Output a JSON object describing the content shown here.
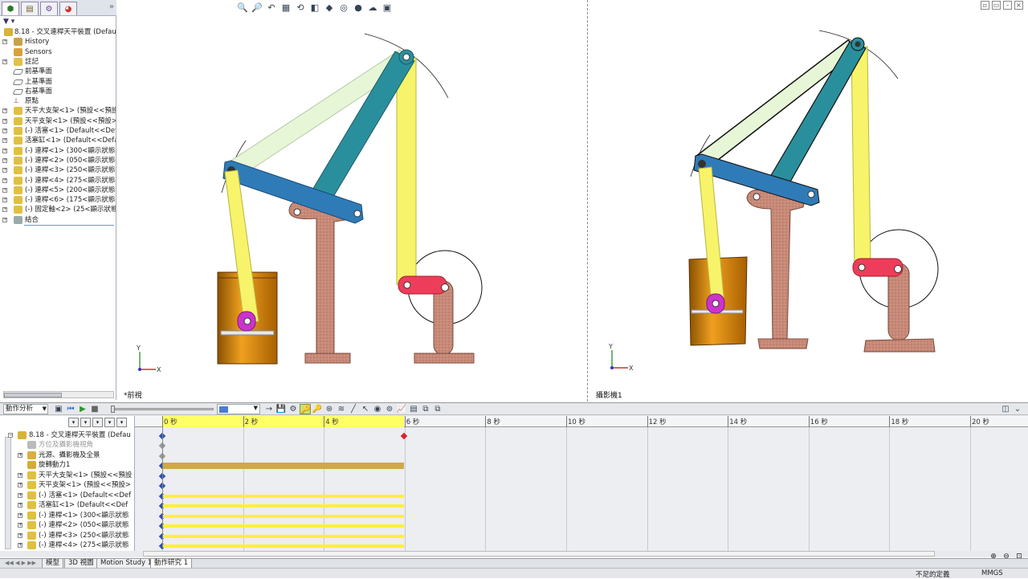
{
  "feature_manager": {
    "tabs": [
      "feature-tree",
      "property-manager",
      "configuration-manager",
      "display-manager"
    ],
    "filter_icon": "filter-icon",
    "items": [
      {
        "label": "8.18 - 交叉連桿天平裝置  (Default",
        "icon": "assembly-icon",
        "expand": ""
      },
      {
        "label": "History",
        "icon": "history-icon",
        "expand": "+"
      },
      {
        "label": "Sensors",
        "icon": "sensors-icon",
        "expand": ""
      },
      {
        "label": "註記",
        "icon": "annotations-icon",
        "expand": "+"
      },
      {
        "label": "前基準面",
        "icon": "plane-icon",
        "expand": ""
      },
      {
        "label": "上基準面",
        "icon": "plane-icon",
        "expand": ""
      },
      {
        "label": "右基準面",
        "icon": "plane-icon",
        "expand": ""
      },
      {
        "label": "原點",
        "icon": "origin-icon",
        "expand": ""
      },
      {
        "label": "天平大支架<1> (預設<<預設",
        "icon": "part-icon",
        "expand": "+"
      },
      {
        "label": "天平支架<1> (預設<<預設>_",
        "icon": "part-icon",
        "expand": "+"
      },
      {
        "label": "(-) 活塞<1> (Default<<Defau",
        "icon": "part-icon",
        "expand": "+"
      },
      {
        "label": "活塞缸<1> (Default<<Defau",
        "icon": "part-icon",
        "expand": "+"
      },
      {
        "label": "(-) 連桿<1> (300<顯示狀態-1",
        "icon": "part-icon",
        "expand": "+"
      },
      {
        "label": "(-) 連桿<2> (050<顯示狀態-3",
        "icon": "part-icon",
        "expand": "+"
      },
      {
        "label": "(-) 連桿<3> (250<顯示狀態-1",
        "icon": "part-icon",
        "expand": "+"
      },
      {
        "label": "(-) 連桿<4> (275<顯示狀態-1",
        "icon": "part-icon",
        "expand": "+"
      },
      {
        "label": "(-) 連桿<5> (200<顯示狀態-9",
        "icon": "part-icon",
        "expand": "+"
      },
      {
        "label": "(-) 連桿<6> (175<顯示狀態-8",
        "icon": "part-icon",
        "expand": "+"
      },
      {
        "label": "(-) 固定軸<2> (25<顯示狀態-",
        "icon": "part-icon",
        "expand": "+"
      },
      {
        "label": "結合",
        "icon": "mates-icon",
        "expand": "+"
      }
    ]
  },
  "viewports": {
    "left_label": "*前視",
    "right_label": "攝影機1"
  },
  "motion_manager": {
    "study_type": "動作分析",
    "filters": [
      "filter-animated-icon",
      "filter-driving-icon",
      "filter-selected-icon",
      "filter-results-icon",
      "autofit-icon"
    ],
    "timeline_ticks": [
      "0 秒",
      "2 秒",
      "4 秒",
      "6 秒",
      "8 秒",
      "10 秒",
      "12 秒",
      "14 秒",
      "16 秒",
      "18 秒",
      "20 秒"
    ],
    "tree": [
      {
        "label": "8.18 - 交叉連桿天平裝置  (Defau",
        "icon": "assembly-icon",
        "expand": "−",
        "indent": 0
      },
      {
        "label": "方位及攝影機視角",
        "icon": "camera-icon",
        "expand": "",
        "indent": 1,
        "muted": true
      },
      {
        "label": "光源、攝影機及全景",
        "icon": "lights-icon",
        "expand": "+",
        "indent": 1
      },
      {
        "label": "旋轉動力1",
        "icon": "rotary-motor-icon",
        "expand": "",
        "indent": 1
      },
      {
        "label": "天平大支架<1> (預設<<預設",
        "icon": "part-icon",
        "expand": "+",
        "indent": 1
      },
      {
        "label": "天平支架<1> (預設<<預設>",
        "icon": "part-icon",
        "expand": "+",
        "indent": 1
      },
      {
        "label": "(-) 活塞<1> (Default<<Def",
        "icon": "part-icon",
        "expand": "+",
        "indent": 1
      },
      {
        "label": "活塞缸<1> (Default<<Def",
        "icon": "part-icon",
        "expand": "+",
        "indent": 1
      },
      {
        "label": "(-) 連桿<1> (300<顯示狀態",
        "icon": "part-icon",
        "expand": "+",
        "indent": 1
      },
      {
        "label": "(-) 連桿<2> (050<顯示狀態",
        "icon": "part-icon",
        "expand": "+",
        "indent": 1
      },
      {
        "label": "(-) 連桿<3> (250<顯示狀態",
        "icon": "part-icon",
        "expand": "+",
        "indent": 1
      },
      {
        "label": "(-) 連桿<4> (275<顯示狀態",
        "icon": "part-icon",
        "expand": "+",
        "indent": 1
      }
    ]
  },
  "bottom_tabs": [
    "模型",
    "3D 視圖",
    "Motion Study 1",
    "動作研究 1"
  ],
  "status": {
    "left": "不足的定義",
    "units": "MMGS"
  },
  "colors": {
    "link_blue": "#2f7bb8",
    "link_teal": "#2a8f9c",
    "link_yellow": "#f7f36a",
    "link_light_green": "#e6f6d6",
    "link_red": "#ee3d5a",
    "bronze": "#c88a78",
    "piston_magenta": "#cc33cc",
    "cylinder_orange": "#d98e12",
    "timeline_highlight": "#ffff66",
    "timeline_bar": "#ffef3a",
    "motor_bar": "#d0a74a"
  }
}
